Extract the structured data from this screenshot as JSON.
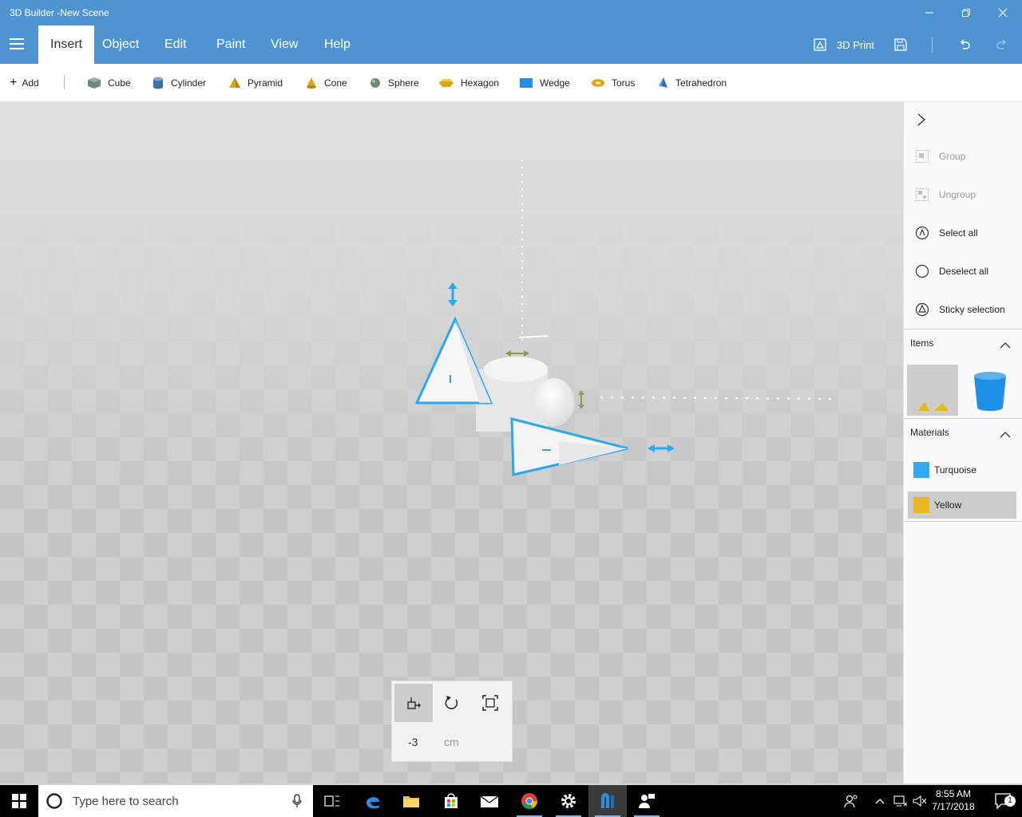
{
  "window": {
    "title": "3D Builder -New Scene",
    "controls": [
      "minimize-icon",
      "restore-icon",
      "close-icon"
    ]
  },
  "ribbon": {
    "tabs": [
      {
        "label": "Insert",
        "active": true
      },
      {
        "label": "Object",
        "active": false
      },
      {
        "label": "Edit",
        "active": false
      },
      {
        "label": "Paint",
        "active": false
      },
      {
        "label": "View",
        "active": false
      },
      {
        "label": "Help",
        "active": false
      }
    ],
    "print_label": "3D Print"
  },
  "toolbar": {
    "add_label": "Add",
    "shapes": [
      {
        "label": "Cube",
        "icon": "cube-icon"
      },
      {
        "label": "Cylinder",
        "icon": "cylinder-icon"
      },
      {
        "label": "Pyramid",
        "icon": "pyramid-icon"
      },
      {
        "label": "Cone",
        "icon": "cone-icon"
      },
      {
        "label": "Sphere",
        "icon": "sphere-icon"
      },
      {
        "label": "Hexagon",
        "icon": "hexagon-icon"
      },
      {
        "label": "Wedge",
        "icon": "wedge-icon"
      },
      {
        "label": "Torus",
        "icon": "torus-icon"
      },
      {
        "label": "Tetrahedron",
        "icon": "tetrahedron-icon"
      }
    ]
  },
  "right_panel": {
    "actions": [
      {
        "label": "Group",
        "enabled": false
      },
      {
        "label": "Ungroup",
        "enabled": false
      },
      {
        "label": "Select all",
        "enabled": true
      },
      {
        "label": "Deselect all",
        "enabled": true
      },
      {
        "label": "Sticky selection",
        "enabled": true
      }
    ],
    "items_header": "Items",
    "materials_header": "Materials",
    "materials": [
      {
        "label": "Turquoise",
        "color": "#35a9f0",
        "selected": false
      },
      {
        "label": "Yellow",
        "color": "#e8b820",
        "selected": true
      }
    ]
  },
  "move_panel": {
    "value": "-3",
    "unit": "cm"
  },
  "taskbar": {
    "search_placeholder": "Type here to search",
    "time": "8:55 AM",
    "date": "7/17/2018",
    "notification_count": "1"
  },
  "colors": {
    "accent": "#4f94d0",
    "selection": "#2aa7ee",
    "gizmo_secondary": "#8f9a52"
  }
}
